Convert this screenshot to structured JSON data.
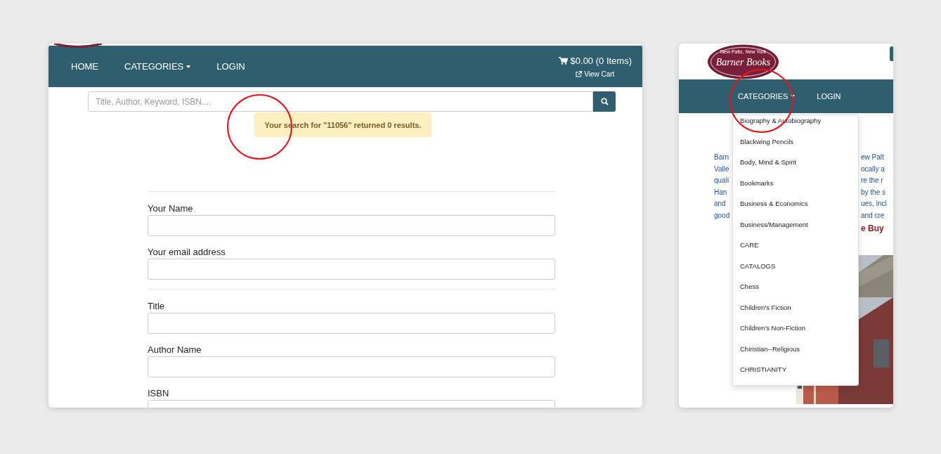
{
  "left_page": {
    "nav": [
      {
        "label": "HOME",
        "dropdown": false
      },
      {
        "label": "CATEGORIES",
        "dropdown": true
      },
      {
        "label": "LOGIN",
        "dropdown": false
      }
    ],
    "cart": {
      "total": "$0.00 (0 Items)",
      "link": "View Cart"
    },
    "search": {
      "placeholder": "Title, Author, Keyword, ISBN...."
    },
    "alert": "Your search for \"11056\" returned 0 results.",
    "form_sections": [
      [
        {
          "label": "Your Name"
        },
        {
          "label": "Your email address"
        }
      ],
      [
        {
          "label": "Title"
        },
        {
          "label": "Author Name"
        },
        {
          "label": "ISBN"
        }
      ]
    ]
  },
  "right_page": {
    "logo": {
      "title": "Barner Books",
      "tagline": "New Paltz, New York"
    },
    "nav": [
      {
        "label": "CATEGORIES",
        "dropdown": true
      },
      {
        "label": "LOGIN",
        "dropdown": false
      }
    ],
    "menu": [
      {
        "label": "Biography & Autobiography"
      },
      {
        "label": "Blackwing Pencils"
      },
      {
        "label": "Body, Mind & Spirit"
      },
      {
        "label": "Bookmarks"
      },
      {
        "label": "Business & Economics"
      },
      {
        "label": "Business/Management"
      },
      {
        "label": "CARE"
      },
      {
        "label": "CATALOGS"
      },
      {
        "label": "Chess"
      },
      {
        "label": "Children's Fiction"
      },
      {
        "label": "Children's Non-Fiction"
      },
      {
        "label": "Chiristian--Religious"
      },
      {
        "label": "CHRISTIANITY"
      }
    ],
    "text_rows": [
      {
        "left": "Barn",
        "right": "ew Palt"
      },
      {
        "left": "Valle",
        "right": "ocally a"
      },
      {
        "left": "quali",
        "right": "re the r"
      },
      {
        "left": "Han",
        "right": "by the s"
      },
      {
        "left": "and",
        "right": "ues, incl"
      },
      {
        "left": "good",
        "right": "and cre"
      }
    ],
    "heading_fragment": "e Buy"
  }
}
